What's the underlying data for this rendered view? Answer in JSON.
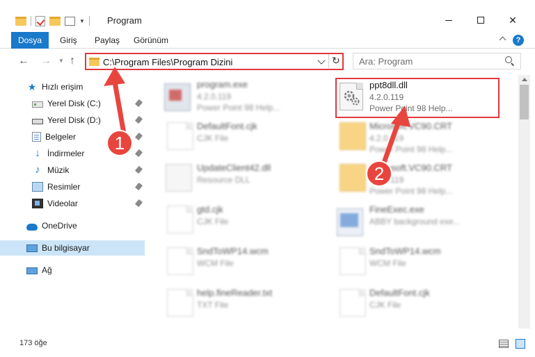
{
  "window": {
    "title": "Program",
    "minimize_label": "—",
    "maximize_label": "☐",
    "close_label": "✕"
  },
  "ribbon": {
    "tabs": [
      {
        "label": "Dosya",
        "active": true
      },
      {
        "label": "Giriş"
      },
      {
        "label": "Paylaş"
      },
      {
        "label": "Görünüm"
      }
    ],
    "help_label": "?"
  },
  "nav": {
    "back_glyph": "←",
    "forward_glyph": "→",
    "up_glyph": "↑",
    "address": "C:\\Program Files\\Program Dizini",
    "refresh_glyph": "↻",
    "search_placeholder": "Ara: Program"
  },
  "sidebar": {
    "items": [
      {
        "label": "Hızlı erişim",
        "icon": "star-icon"
      },
      {
        "label": "Yerel Disk (C:)",
        "icon": "disk-icon",
        "pinned": true
      },
      {
        "label": "Yerel Disk (D:)",
        "icon": "disk-icon",
        "pinned": true
      },
      {
        "label": "Belgeler",
        "icon": "documents-icon",
        "pinned": true
      },
      {
        "label": "İndirmeler",
        "icon": "downloads-icon",
        "pinned": true
      },
      {
        "label": "Müzik",
        "icon": "music-icon",
        "pinned": true
      },
      {
        "label": "Resimler",
        "icon": "pictures-icon",
        "pinned": true
      },
      {
        "label": "Videolar",
        "icon": "videos-icon",
        "pinned": true
      },
      {
        "label": "OneDrive",
        "icon": "cloud-icon"
      },
      {
        "label": "Bu bilgisayar",
        "icon": "pc-icon",
        "selected": true
      },
      {
        "label": "Ağ",
        "icon": "network-icon"
      }
    ]
  },
  "files": {
    "highlighted": {
      "name": "ppt8dll.dll",
      "version": "4.2.0.119",
      "description": "Power Point 98 Help..."
    },
    "left": [
      {
        "name": "program.exe",
        "line1": "4.2.0.119",
        "line2": "Power Point 98 Help..."
      },
      {
        "name": "DefaultFont.cjk",
        "line1": "CJK File",
        "line2": ""
      },
      {
        "name": "UpdateClient42.dll",
        "line1": "Resource DLL",
        "line2": ""
      },
      {
        "name": "gtd.cjk",
        "line1": "CJK File",
        "line2": ""
      },
      {
        "name": "SndToWP14.wcm",
        "line1": "WCM File",
        "line2": ""
      },
      {
        "name": "help.fineReader.txt",
        "line1": "TXT File",
        "line2": ""
      }
    ],
    "right": [
      {
        "name": "Microsoft.VC90.CRT",
        "line1": "4.2.0.119",
        "line2": "Power Point 98 Help..."
      },
      {
        "name": "Microsoft.VC90.CRT",
        "line1": "4.2.0.119",
        "line2": "Power Point 98 Help..."
      },
      {
        "name": "FineExec.exe",
        "line1": "ABBY background exe...",
        "line2": ""
      },
      {
        "name": "SndToWP14.wcm",
        "line1": "WCM File",
        "line2": ""
      },
      {
        "name": "DefaultFont.cjk",
        "line1": "CJK File",
        "line2": ""
      }
    ]
  },
  "status": {
    "item_count": "173 öğe"
  },
  "annotations": [
    {
      "label": "1"
    },
    {
      "label": "2"
    }
  ],
  "colors": {
    "accent": "#1979ca",
    "highlight": "#e0383e"
  }
}
